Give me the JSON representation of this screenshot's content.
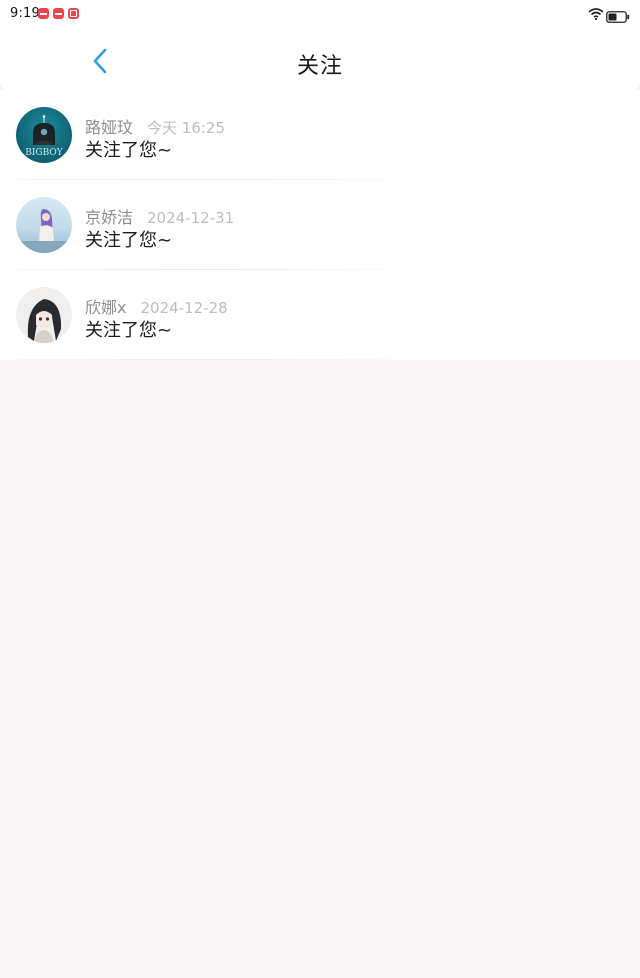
{
  "status_bar": {
    "time": "9:19",
    "notification_icons": [
      "app-notification-icon",
      "app-notification-icon",
      "tv-notification-icon"
    ],
    "wifi_icon": "wifi-icon",
    "battery_icon": "battery-icon"
  },
  "header": {
    "back_icon": "chevron-left-icon",
    "title": "关注"
  },
  "follows": [
    {
      "name": "路娅玟",
      "time": "今天 16:25",
      "message": "关注了您~",
      "avatar_text": "BIGBOY"
    },
    {
      "name": "京娇洁",
      "time": "2024-12-31",
      "message": "关注了您~"
    },
    {
      "name": "欣娜x",
      "time": "2024-12-28",
      "message": "关注了您~"
    }
  ],
  "colors": {
    "accent": "#2d9fe0",
    "page_background": "#f8f6f7",
    "name_text": "#8e8e8e",
    "time_text": "#bdbdbd",
    "notification_red": "#e8464b"
  }
}
